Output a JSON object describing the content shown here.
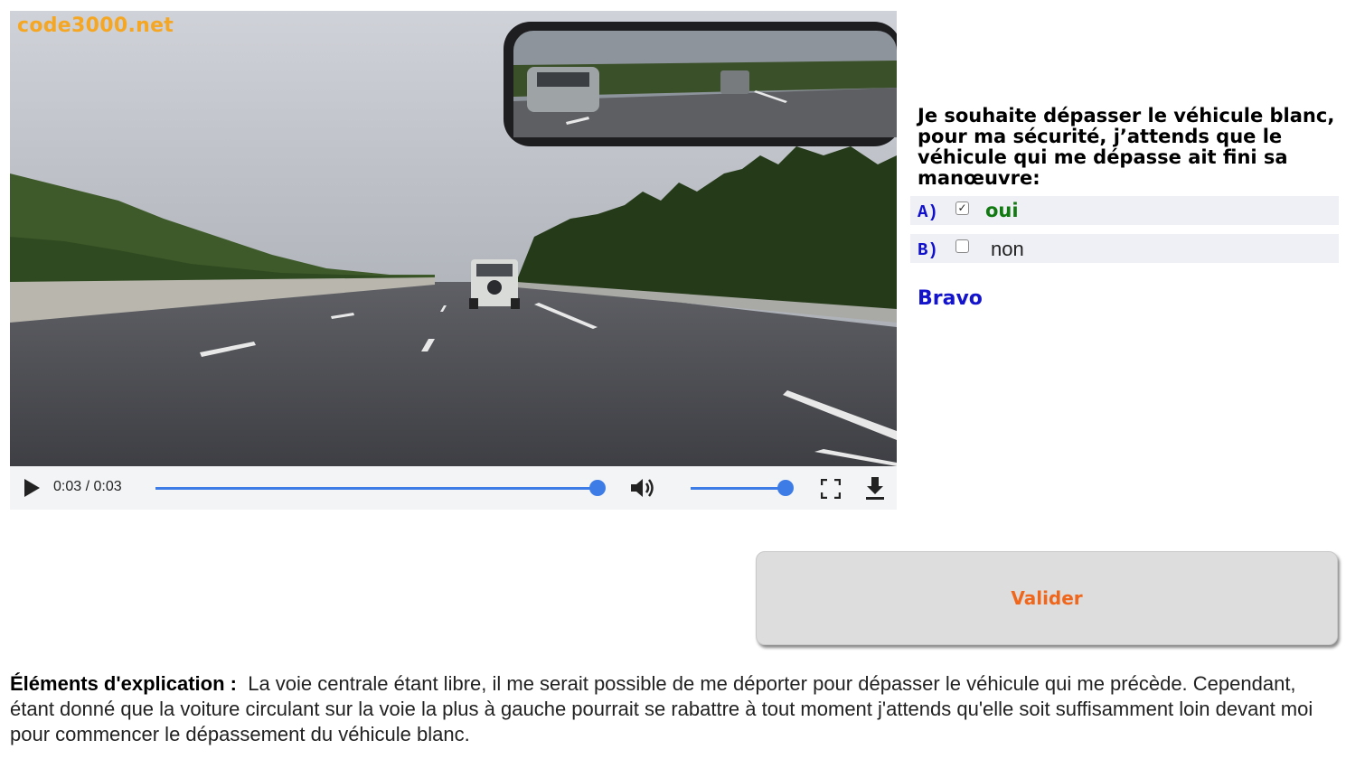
{
  "video": {
    "watermark": "code3000.net",
    "time": "0:03 / 0:03",
    "progress": 1.0,
    "volume": 1.0,
    "icons": [
      "play-icon",
      "volume-icon",
      "fullscreen-icon",
      "download-icon"
    ]
  },
  "question": {
    "text": "Je souhaite dépasser le véhicule blanc, pour ma sécurité, j’attends que le véhicule qui me dépasse ait fini sa manœuvre:",
    "answers": [
      {
        "letter": "A)",
        "text": "oui",
        "checked": true
      },
      {
        "letter": "B)",
        "text": "non",
        "checked": false
      }
    ],
    "feedback": "Bravo"
  },
  "submit_label": "Valider",
  "explanation": {
    "label": "Éléments d'explication :",
    "text": "La voie centrale étant libre, il me serait possible de me déporter pour dépasser le véhicule qui me précède. Cependant, étant donné que la voiture circulant sur la voie la plus à gauche pourrait se rabattre à tout moment j'attends qu'elle soit suffisamment loin devant moi pour commencer le dépassement du véhicule blanc."
  },
  "colors": {
    "accent_blue": "#1414cc",
    "correct_green": "#117a11",
    "button_text": "#f0661a",
    "watermark": "#f5a623",
    "player_blue": "#3d7ce6"
  }
}
